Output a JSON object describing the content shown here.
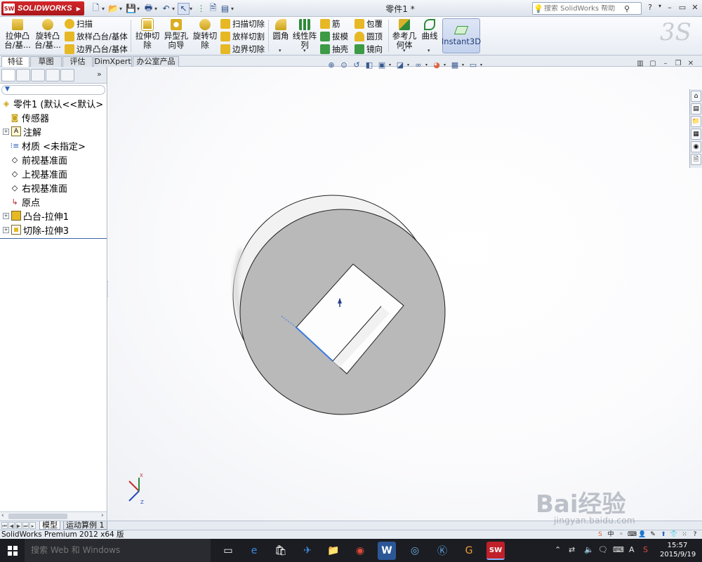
{
  "titlebar": {
    "app_name": "SOLIDWORKS",
    "doc_title": "零件1 *",
    "help_search_placeholder": "搜索 SolidWorks 帮助",
    "help_label": "?",
    "minimize": "–",
    "restore": "▭",
    "close": "✕"
  },
  "ribbon": {
    "extrude_boss": [
      "拉伸凸",
      "台/基..."
    ],
    "revolve_boss": [
      "旋转凸",
      "台/基..."
    ],
    "sweep": "扫描",
    "loft_boss": "放样凸台/基体",
    "boundary_boss": "边界凸台/基体",
    "extrude_cut": [
      "拉伸切",
      "除"
    ],
    "hole_wizard": [
      "异型孔",
      "向导"
    ],
    "revolve_cut": [
      "旋转切",
      "除"
    ],
    "sweep_cut": "扫描切除",
    "loft_cut": "放样切割",
    "boundary_cut": "边界切除",
    "fillet": "圆角",
    "linear_pattern": [
      "线性阵",
      "列"
    ],
    "rib": "筋",
    "draft": "拔模",
    "shell": "抽壳",
    "wrap": "包覆",
    "dome": "圆顶",
    "mirror": "镜向",
    "ref_geometry": [
      "参考几",
      "何体"
    ],
    "curves": "曲线",
    "instant3d": "Instant3D"
  },
  "tabs": [
    "特征",
    "草图",
    "评估",
    "DimXpert",
    "办公室产品"
  ],
  "feature_tree": {
    "root": "零件1 (默认<<默认>",
    "items": [
      {
        "label": "传感器",
        "expandable": false
      },
      {
        "label": "注解",
        "expandable": true
      },
      {
        "label": "材质 <未指定>",
        "expandable": false
      },
      {
        "label": "前视基准面",
        "expandable": false
      },
      {
        "label": "上视基准面",
        "expandable": false
      },
      {
        "label": "右视基准面",
        "expandable": false
      },
      {
        "label": "原点",
        "expandable": false
      },
      {
        "label": "凸台-拉伸1",
        "expandable": true
      },
      {
        "label": "切除-拉伸3",
        "expandable": true
      }
    ]
  },
  "triad": {
    "x": "X",
    "y": "Y",
    "z": "Z"
  },
  "bottom_tabs": [
    "模型",
    "运动算例 1"
  ],
  "status_bar": {
    "text": "SolidWorks Premium 2012 x64 版"
  },
  "taskbar": {
    "search_placeholder": "搜索 Web 和 Windows",
    "clock_time": "15:57",
    "clock_date": "2015/9/19",
    "ime": "A"
  },
  "watermark": {
    "brand": "Bai经验",
    "url": "jingyan.baidu.com"
  },
  "colors": {
    "brand_red": "#c0202a",
    "accent_blue": "#2b63b8",
    "part_face": "#b8b8b8",
    "part_side": "#f4f4f4",
    "tree_separator": "#3d66a8"
  }
}
